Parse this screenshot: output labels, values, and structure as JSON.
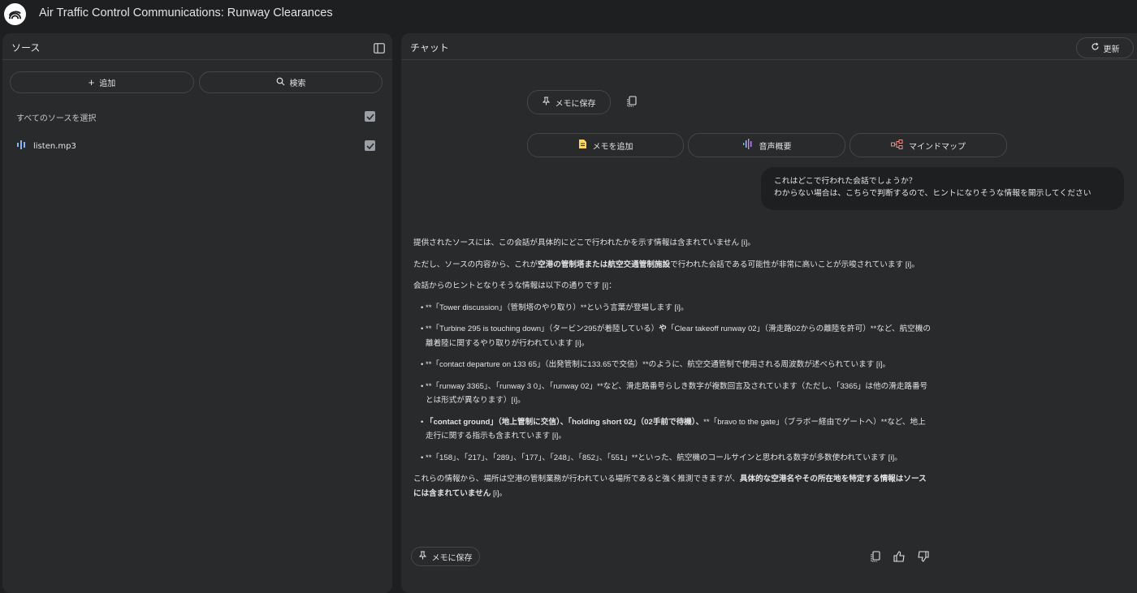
{
  "app": {
    "title": "Air Traffic Control Communications: Runway Clearances"
  },
  "sources": {
    "title": "ソース",
    "add_label": "追加",
    "search_label": "検索",
    "select_all_label": "すべてのソースを選択",
    "items": [
      {
        "name": "listen.mp3",
        "checked": true
      }
    ]
  },
  "chat": {
    "title": "チャット",
    "refresh_label": "更新",
    "save_note_label": "メモに保存",
    "add_note_label": "メモを追加",
    "audio_overview_label": "音声概要",
    "mindmap_label": "マインドマップ",
    "user_message": {
      "line1": "これはどこで行われた会話でしょうか？",
      "line2": "わからない場合は、こちらで判断するので、ヒントになりそうな情報を開示してください"
    },
    "answer": {
      "p1": "提供されたソースには、この会話が具体的にどこで行われたかを示す情報は含まれていません [i]。",
      "p2_a": "ただし、ソースの内容から、これが",
      "p2_b": "空港の管制塔または航空交通管制施設",
      "p2_c": "で行われた会話である可能性が非常に高いことが示唆されています [i]。",
      "p3": "会話からのヒントとなりそうな情報は以下の通りです [i]：",
      "b1": "**「Tower discussion」（管制塔のやり取り）**という言葉が登場します [i]。",
      "b2_a": "**「Turbine 295 is touching down」（タービン295が着陸している）",
      "b2_b": "や",
      "b2_c": "「Clear takeoff runway 02」（滑走路02からの離陸を許可）**など、航空機の離着陸に関するやり取りが行われています [i]。",
      "b3": "**「contact departure on 133 65」（出発管制に133.65で交信）**のように、航空交通管制で使用される周波数が述べられています [i]。",
      "b4": "**「runway 3365」、「runway 3 0」、「runway 02」**など、滑走路番号らしき数字が複数回言及されています（ただし、「3365」は他の滑走路番号とは形式が異なります）[i]。",
      "b5_a": "「contact ground」（地上管制に交信）、「holding short 02」（02手前で待機）、",
      "b5_b": "**「bravo to the gate」（ブラボー経由でゲートへ）**など、地上走行に関する指示も含まれています [i]。",
      "b6": "**「158」、「217」、「289」、「177」、「248」、「852」、「551」**といった、航空機のコールサインと思われる数字が多数使われています [i]。",
      "p4_a": "これらの情報から、場所は空港の管制業務が行われている場所であると強く推測できますが、",
      "p4_b": "具体的な空港名やその所在地を特定する情報はソースには含まれていません",
      "p4_c": " [i]。"
    }
  }
}
